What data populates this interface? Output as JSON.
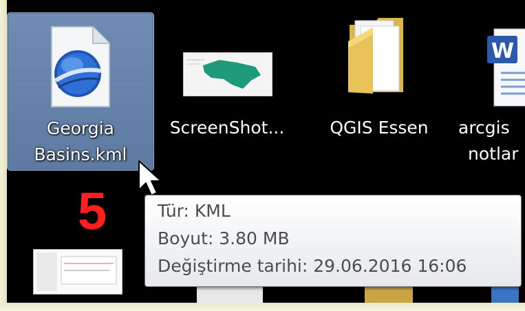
{
  "desktop": {
    "icons": [
      {
        "label_line1": "Georgia",
        "label_line2": "Basins.kml",
        "icon": "google-earth-kml-file-icon",
        "selected": true
      },
      {
        "label_line1": "ScreenShot...",
        "label_line2": "",
        "icon": "screenshot-thumbnail-icon"
      },
      {
        "label_line1": "QGIS Essen",
        "label_line2": "",
        "icon": "folder-icon"
      },
      {
        "label_line1": "arcgis",
        "label_line2": "notlar",
        "icon": "word-document-icon"
      }
    ]
  },
  "annotation": {
    "step_number": "5"
  },
  "tooltip": {
    "type_line": "Tür: KML",
    "size_line": "Boyut: 3.80 MB",
    "modified_line": "Değiştirme tarihi: 29.06.2016 16:06"
  },
  "colors": {
    "selection": "#6482aa",
    "annotation_red": "#ff1f1f"
  }
}
